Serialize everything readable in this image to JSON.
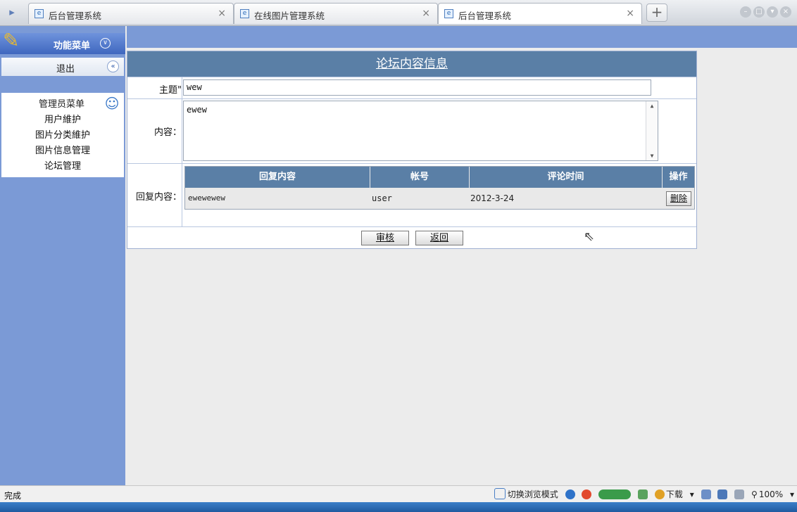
{
  "browser": {
    "tabs": [
      {
        "title": "后台管理系统",
        "active": false
      },
      {
        "title": "在线图片管理系统",
        "active": false
      },
      {
        "title": "后台管理系统",
        "active": true
      }
    ],
    "new_tab": "+",
    "close_glyph": "×"
  },
  "sidebar": {
    "menu_title": "功能菜单",
    "logout": "退出",
    "admin_menu_title": "管理员菜单",
    "items": [
      "用户維护",
      "图片分类維护",
      "图片信息管理",
      "论坛管理"
    ]
  },
  "panel": {
    "title": "论坛内容信息",
    "subject_label": "主题\"",
    "subject_value": "wew",
    "content_label": "内容：",
    "content_value": "ewew",
    "reply_label": "回复内容：",
    "reply_table": {
      "headers": [
        "回复内容",
        "帐号",
        "评论时间",
        "操作"
      ],
      "rows": [
        {
          "content": "ewewewew",
          "account": "user",
          "time": "2012-3-24",
          "action": "删除"
        }
      ]
    },
    "buttons": {
      "review": "审核",
      "back": "返回"
    }
  },
  "statusbar": {
    "status": "完成",
    "switch_mode": "切换浏览模式",
    "download": "下载",
    "zoom": "100%"
  },
  "colors": {
    "sidebar_bg": "#7b9ad6",
    "header_bar": "#5a7fa6"
  }
}
